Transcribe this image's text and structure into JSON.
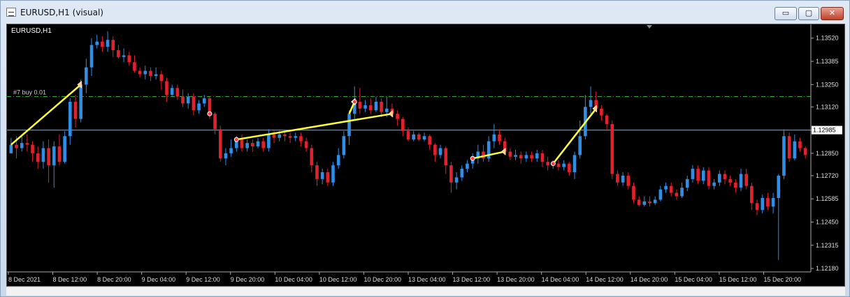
{
  "window": {
    "title": "EURUSD,H1 (visual)",
    "minimize_glyph": "▭",
    "maximize_glyph": "▢",
    "close_glyph": "✕"
  },
  "chart": {
    "symbol_label": "EURUSD,H1",
    "order_label": "#7 buy 0.01",
    "current_price": "1.12985",
    "colors": {
      "background": "#000000",
      "bull": "#2f8fe6",
      "bear": "#e3202d",
      "trade_line": "#ffff33",
      "order_line": "#33aa33",
      "price_line": "#8fa8c0"
    }
  },
  "chart_data": {
    "type": "candlestick",
    "symbol": "EURUSD",
    "timeframe": "H1",
    "y_ticks": [
      "1.13520",
      "1.13385",
      "1.13250",
      "1.13120",
      "1.12985",
      "1.12850",
      "1.12720",
      "1.12585",
      "1.12450",
      "1.12315",
      "1.12180"
    ],
    "x_ticks": [
      "8 Dec 2021",
      "8 Dec 12:00",
      "8 Dec 20:00",
      "9 Dec 04:00",
      "9 Dec 12:00",
      "9 Dec 20:00",
      "10 Dec 04:00",
      "10 Dec 12:00",
      "10 Dec 20:00",
      "13 Dec 04:00",
      "13 Dec 12:00",
      "13 Dec 20:00",
      "14 Dec 04:00",
      "14 Dec 12:00",
      "14 Dec 20:00",
      "15 Dec 04:00",
      "15 Dec 12:00",
      "15 Dec 20:00"
    ],
    "ylim": [
      1.1216,
      1.136
    ],
    "order_level": 1.1318,
    "current_price": 1.12985,
    "candles": [
      [
        1.1285,
        1.129,
        1.1286,
        1.1294
      ],
      [
        1.129,
        1.1288,
        1.1282,
        1.1295
      ],
      [
        1.1288,
        1.1291,
        1.1286,
        1.1295
      ],
      [
        1.1291,
        1.129,
        1.1286,
        1.1296
      ],
      [
        1.129,
        1.1285,
        1.128,
        1.1292
      ],
      [
        1.1285,
        1.128,
        1.1276,
        1.1289
      ],
      [
        1.128,
        1.1288,
        1.1276,
        1.1292
      ],
      [
        1.1288,
        1.1278,
        1.1268,
        1.1293
      ],
      [
        1.1278,
        1.1289,
        1.1265,
        1.1292
      ],
      [
        1.1289,
        1.128,
        1.1278,
        1.1296
      ],
      [
        1.128,
        1.1295,
        1.1279,
        1.1298
      ],
      [
        1.1295,
        1.1315,
        1.129,
        1.1317
      ],
      [
        1.1315,
        1.1305,
        1.13,
        1.1319
      ],
      [
        1.1305,
        1.1325,
        1.1303,
        1.1328
      ],
      [
        1.1325,
        1.1335,
        1.132,
        1.134
      ],
      [
        1.1335,
        1.1348,
        1.133,
        1.1352
      ],
      [
        1.1348,
        1.135,
        1.1346,
        1.1354
      ],
      [
        1.135,
        1.1347,
        1.1344,
        1.1353
      ],
      [
        1.1347,
        1.1351,
        1.1344,
        1.1356
      ],
      [
        1.1351,
        1.1345,
        1.1341,
        1.1353
      ],
      [
        1.1345,
        1.1341,
        1.134,
        1.1348
      ],
      [
        1.1341,
        1.1342,
        1.1338,
        1.1346
      ],
      [
        1.1342,
        1.1338,
        1.1336,
        1.1344
      ],
      [
        1.1338,
        1.1333,
        1.1332,
        1.1342
      ],
      [
        1.1333,
        1.1331,
        1.1329,
        1.1335
      ],
      [
        1.1331,
        1.1333,
        1.1328,
        1.1336
      ],
      [
        1.1333,
        1.133,
        1.1327,
        1.1335
      ],
      [
        1.133,
        1.1331,
        1.1328,
        1.1335
      ],
      [
        1.1331,
        1.1327,
        1.1322,
        1.1333
      ],
      [
        1.1327,
        1.1319,
        1.1315,
        1.1329
      ],
      [
        1.1319,
        1.1323,
        1.1318,
        1.1325
      ],
      [
        1.1323,
        1.1318,
        1.1316,
        1.1325
      ],
      [
        1.1318,
        1.1314,
        1.1312,
        1.1322
      ],
      [
        1.1314,
        1.1318,
        1.1311,
        1.132
      ],
      [
        1.1318,
        1.131,
        1.1307,
        1.132
      ],
      [
        1.131,
        1.1314,
        1.1308,
        1.1316
      ],
      [
        1.1314,
        1.1317,
        1.1312,
        1.1319
      ],
      [
        1.1317,
        1.1308,
        1.1305,
        1.1318
      ],
      [
        1.1308,
        1.1299,
        1.1296,
        1.1309
      ],
      [
        1.1299,
        1.1282,
        1.128,
        1.1301
      ],
      [
        1.1282,
        1.1285,
        1.1278,
        1.1288
      ],
      [
        1.1285,
        1.1288,
        1.1283,
        1.1293
      ],
      [
        1.1288,
        1.1293,
        1.1286,
        1.1295
      ],
      [
        1.1293,
        1.1288,
        1.1286,
        1.1296
      ],
      [
        1.1288,
        1.1291,
        1.1286,
        1.1293
      ],
      [
        1.1291,
        1.1289,
        1.1286,
        1.1293
      ],
      [
        1.1289,
        1.1292,
        1.1288,
        1.1294
      ],
      [
        1.1292,
        1.1288,
        1.1286,
        1.1294
      ],
      [
        1.1288,
        1.1296,
        1.1286,
        1.1299
      ],
      [
        1.1296,
        1.1294,
        1.1291,
        1.1298
      ],
      [
        1.1294,
        1.1296,
        1.1292,
        1.1298
      ],
      [
        1.1296,
        1.1295,
        1.1292,
        1.1298
      ],
      [
        1.1295,
        1.1294,
        1.1291,
        1.1297
      ],
      [
        1.1294,
        1.1295,
        1.1292,
        1.1297
      ],
      [
        1.1295,
        1.1292,
        1.1289,
        1.1297
      ],
      [
        1.1292,
        1.1288,
        1.1286,
        1.1294
      ],
      [
        1.1288,
        1.1278,
        1.1274,
        1.129
      ],
      [
        1.1278,
        1.127,
        1.1266,
        1.128
      ],
      [
        1.127,
        1.1274,
        1.1267,
        1.1276
      ],
      [
        1.1274,
        1.1268,
        1.1266,
        1.1276
      ],
      [
        1.1268,
        1.1278,
        1.1266,
        1.128
      ],
      [
        1.1278,
        1.1284,
        1.1276,
        1.1288
      ],
      [
        1.1284,
        1.1295,
        1.1282,
        1.1298
      ],
      [
        1.1295,
        1.1308,
        1.129,
        1.131
      ],
      [
        1.1308,
        1.1315,
        1.1305,
        1.1324
      ],
      [
        1.1315,
        1.1311,
        1.1308,
        1.1323
      ],
      [
        1.1311,
        1.1313,
        1.1309,
        1.1316
      ],
      [
        1.1313,
        1.131,
        1.1308,
        1.1317
      ],
      [
        1.131,
        1.1315,
        1.1309,
        1.1318
      ],
      [
        1.1315,
        1.1309,
        1.1306,
        1.1317
      ],
      [
        1.1309,
        1.1311,
        1.1306,
        1.1318
      ],
      [
        1.1311,
        1.1308,
        1.1306,
        1.1314
      ],
      [
        1.1308,
        1.1305,
        1.1301,
        1.131
      ],
      [
        1.1305,
        1.1298,
        1.1295,
        1.1306
      ],
      [
        1.1298,
        1.1293,
        1.1292,
        1.13
      ],
      [
        1.1293,
        1.1296,
        1.1292,
        1.1298
      ],
      [
        1.1296,
        1.1293,
        1.1292,
        1.1297
      ],
      [
        1.1293,
        1.1295,
        1.1292,
        1.1297
      ],
      [
        1.1295,
        1.129,
        1.1287,
        1.1296
      ],
      [
        1.129,
        1.1284,
        1.128,
        1.1291
      ],
      [
        1.1284,
        1.1288,
        1.1282,
        1.129
      ],
      [
        1.1288,
        1.1278,
        1.1273,
        1.1289
      ],
      [
        1.1278,
        1.1268,
        1.1262,
        1.128
      ],
      [
        1.1268,
        1.1271,
        1.1264,
        1.1274
      ],
      [
        1.1271,
        1.1276,
        1.1269,
        1.1278
      ],
      [
        1.1276,
        1.1279,
        1.1274,
        1.1281
      ],
      [
        1.1279,
        1.1282,
        1.1276,
        1.1285
      ],
      [
        1.1282,
        1.1286,
        1.1279,
        1.129
      ],
      [
        1.1286,
        1.1282,
        1.128,
        1.129
      ],
      [
        1.1282,
        1.1292,
        1.128,
        1.1295
      ],
      [
        1.1292,
        1.1296,
        1.1288,
        1.1302
      ],
      [
        1.1296,
        1.1292,
        1.129,
        1.1299
      ],
      [
        1.1292,
        1.1286,
        1.1284,
        1.1294
      ],
      [
        1.1286,
        1.1283,
        1.1281,
        1.1288
      ],
      [
        1.1283,
        1.1284,
        1.1281,
        1.1287
      ],
      [
        1.1284,
        1.1282,
        1.1279,
        1.1286
      ],
      [
        1.1282,
        1.1284,
        1.128,
        1.1286
      ],
      [
        1.1284,
        1.1282,
        1.128,
        1.1286
      ],
      [
        1.1282,
        1.1285,
        1.128,
        1.1287
      ],
      [
        1.1285,
        1.128,
        1.1277,
        1.1287
      ],
      [
        1.128,
        1.1278,
        1.1275,
        1.1283
      ],
      [
        1.1278,
        1.1279,
        1.1276,
        1.1281
      ],
      [
        1.1279,
        1.1277,
        1.1275,
        1.1281
      ],
      [
        1.1277,
        1.1279,
        1.1275,
        1.1281
      ],
      [
        1.1279,
        1.1274,
        1.1272,
        1.128
      ],
      [
        1.1274,
        1.1284,
        1.127,
        1.1286
      ],
      [
        1.1284,
        1.1295,
        1.1282,
        1.1304
      ],
      [
        1.1295,
        1.1312,
        1.1293,
        1.1319
      ],
      [
        1.1312,
        1.1316,
        1.1308,
        1.1324
      ],
      [
        1.1316,
        1.1311,
        1.1309,
        1.1321
      ],
      [
        1.1311,
        1.1307,
        1.1304,
        1.1313
      ],
      [
        1.1307,
        1.1302,
        1.1298,
        1.1308
      ],
      [
        1.1302,
        1.1273,
        1.127,
        1.1304
      ],
      [
        1.1273,
        1.1268,
        1.1266,
        1.1275
      ],
      [
        1.1268,
        1.1272,
        1.1266,
        1.1274
      ],
      [
        1.1272,
        1.1266,
        1.1264,
        1.1274
      ],
      [
        1.1266,
        1.1258,
        1.1256,
        1.1268
      ],
      [
        1.1258,
        1.1255,
        1.1254,
        1.126
      ],
      [
        1.1255,
        1.1257,
        1.1254,
        1.126
      ],
      [
        1.1257,
        1.1256,
        1.1254,
        1.126
      ],
      [
        1.1256,
        1.1258,
        1.1255,
        1.126
      ],
      [
        1.1258,
        1.1264,
        1.1257,
        1.1266
      ],
      [
        1.1264,
        1.1266,
        1.1262,
        1.1268
      ],
      [
        1.1266,
        1.1262,
        1.126,
        1.1268
      ],
      [
        1.1262,
        1.126,
        1.1258,
        1.1264
      ],
      [
        1.126,
        1.1265,
        1.1259,
        1.1268
      ],
      [
        1.1265,
        1.127,
        1.1263,
        1.1272
      ],
      [
        1.127,
        1.1276,
        1.1268,
        1.1278
      ],
      [
        1.1276,
        1.1269,
        1.1267,
        1.1278
      ],
      [
        1.1269,
        1.1275,
        1.1267,
        1.1277
      ],
      [
        1.1275,
        1.1266,
        1.1264,
        1.1277
      ],
      [
        1.1266,
        1.1268,
        1.1264,
        1.127
      ],
      [
        1.1268,
        1.1273,
        1.1266,
        1.1275
      ],
      [
        1.1273,
        1.127,
        1.1267,
        1.1275
      ],
      [
        1.127,
        1.1268,
        1.1266,
        1.1272
      ],
      [
        1.1268,
        1.1265,
        1.1262,
        1.127
      ],
      [
        1.1265,
        1.1273,
        1.1263,
        1.1276
      ],
      [
        1.1273,
        1.1266,
        1.1264,
        1.1276
      ],
      [
        1.1266,
        1.1256,
        1.1252,
        1.1268
      ],
      [
        1.1256,
        1.1252,
        1.1249,
        1.1258
      ],
      [
        1.1252,
        1.1259,
        1.125,
        1.1261
      ],
      [
        1.1259,
        1.1254,
        1.1252,
        1.1262
      ],
      [
        1.1254,
        1.1259,
        1.125,
        1.1262
      ],
      [
        1.1259,
        1.1272,
        1.1223,
        1.1273
      ],
      [
        1.1272,
        1.1295,
        1.127,
        1.1299
      ],
      [
        1.1295,
        1.1282,
        1.128,
        1.1297
      ],
      [
        1.1282,
        1.1292,
        1.1281,
        1.1296
      ],
      [
        1.1292,
        1.1288,
        1.1286,
        1.1294
      ],
      [
        1.1288,
        1.1284,
        1.1282,
        1.1289
      ]
    ]
  }
}
